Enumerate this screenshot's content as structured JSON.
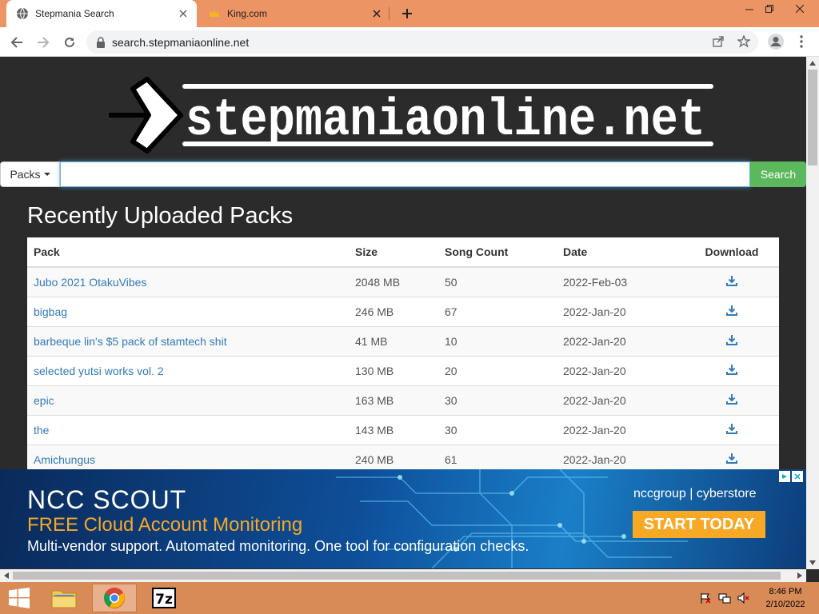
{
  "browser": {
    "tabs": [
      {
        "title": "Stepmania Search",
        "active": true
      },
      {
        "title": "King.com",
        "active": false
      }
    ],
    "address": "search.stepmaniaonline.net"
  },
  "site": {
    "logo_text": "stepmaniaonline.net",
    "search": {
      "dropdown_label": "Packs",
      "placeholder": "",
      "button_label": "Search"
    },
    "heading": "Recently Uploaded Packs",
    "table": {
      "headers": [
        "Pack",
        "Size",
        "Song Count",
        "Date",
        "Download"
      ],
      "rows": [
        {
          "pack": "Jubo 2021 OtakuVibes",
          "size": "2048 MB",
          "count": "50",
          "date": "2022-Feb-03"
        },
        {
          "pack": "bigbag",
          "size": "246 MB",
          "count": "67",
          "date": "2022-Jan-20"
        },
        {
          "pack": "barbeque lin's $5 pack of stamtech shit",
          "size": "41 MB",
          "count": "10",
          "date": "2022-Jan-20"
        },
        {
          "pack": "selected yutsi works vol. 2",
          "size": "130 MB",
          "count": "20",
          "date": "2022-Jan-20"
        },
        {
          "pack": "epic",
          "size": "163 MB",
          "count": "30",
          "date": "2022-Jan-20"
        },
        {
          "pack": "the",
          "size": "143 MB",
          "count": "30",
          "date": "2022-Jan-20"
        },
        {
          "pack": "Amichungus",
          "size": "240 MB",
          "count": "61",
          "date": "2022-Jan-20"
        }
      ]
    }
  },
  "ad": {
    "title": "NCC SCOUT",
    "subtitle": "FREE Cloud Account Monitoring",
    "line": "Multi-vendor support. Automated monitoring. One tool for configuration checks.",
    "brand": "nccgroup | cyberstore",
    "cta": "START TODAY"
  },
  "taskbar": {
    "time": "8:46 PM",
    "date": "2/10/2022"
  },
  "colors": {
    "tabstrip": "#ec9463",
    "page_bg": "#2b2b2b",
    "search_button": "#5cb85c",
    "link": "#337ab7",
    "taskbar": "#d88a57",
    "ad_cta": "#f7a825"
  }
}
